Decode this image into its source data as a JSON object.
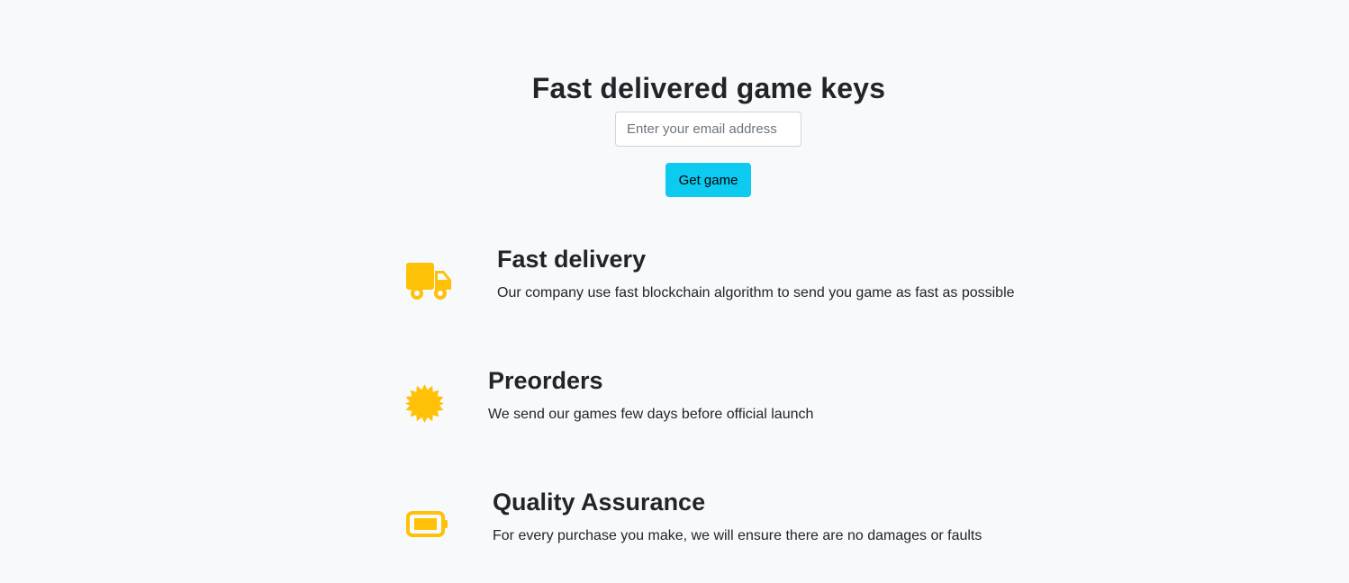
{
  "hero": {
    "title": "Fast delivered game keys",
    "email_placeholder": "Enter your email address",
    "email_value": "",
    "button_label": "Get game"
  },
  "features": [
    {
      "icon": "truck-icon",
      "title": "Fast delivery",
      "text": "Our company use fast blockchain algorithm to send you game as fast as possible"
    },
    {
      "icon": "badge-icon",
      "title": "Preorders",
      "text": "We send our games few days before official launch"
    },
    {
      "icon": "battery-icon",
      "title": "Quality Assurance",
      "text": "For every purchase you make, we will ensure there are no damages or faults"
    }
  ],
  "colors": {
    "background": "#f8f9fa",
    "accent_button": "#0dcaf0",
    "icon": "#ffc107",
    "text": "#212529"
  }
}
